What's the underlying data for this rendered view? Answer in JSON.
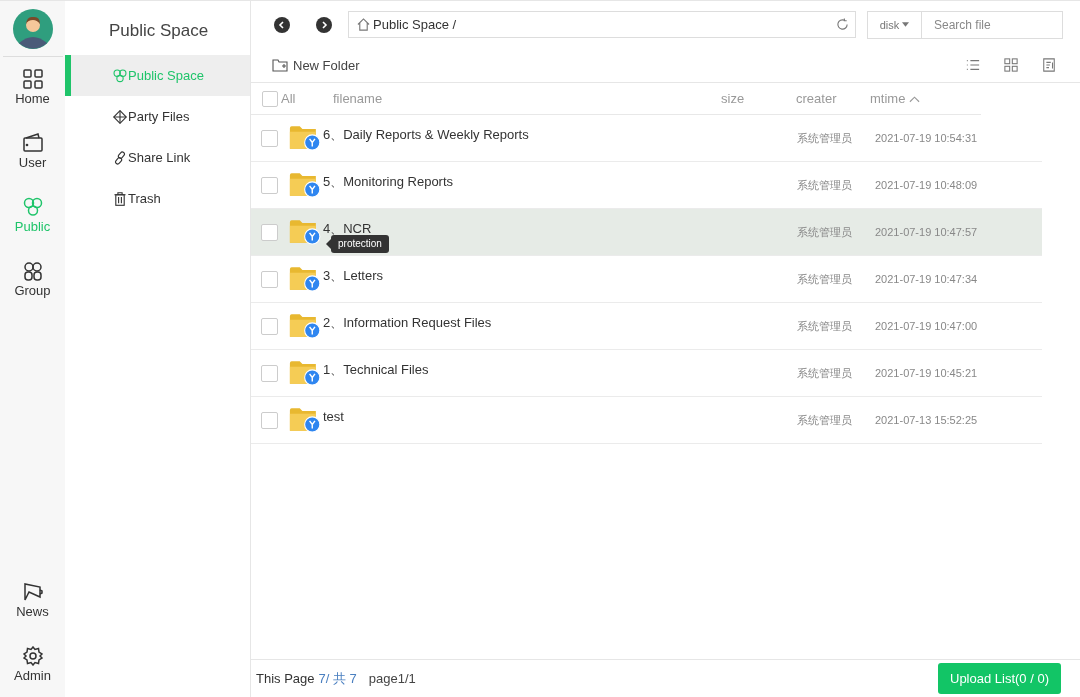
{
  "rail": {
    "items": [
      {
        "label": "Home",
        "selected": false
      },
      {
        "label": "User",
        "selected": false
      },
      {
        "label": "Public",
        "selected": true
      },
      {
        "label": "Group",
        "selected": false
      }
    ],
    "bottom_items": [
      {
        "label": "News",
        "selected": false
      },
      {
        "label": "Admin",
        "selected": false
      }
    ]
  },
  "sidebar": {
    "title": "Public Space",
    "items": [
      {
        "label": "Public Space",
        "selected": true
      },
      {
        "label": "Party Files",
        "selected": false
      },
      {
        "label": "Share Link",
        "selected": false
      },
      {
        "label": "Trash",
        "selected": false
      }
    ]
  },
  "toolbar": {
    "path": "Public Space /",
    "disk": "disk",
    "search": {
      "placeholder": "Search file"
    },
    "new_folder": "New Folder"
  },
  "table": {
    "select_all_checked": false,
    "columns": {
      "all": "All",
      "filename": "filename",
      "size": "size",
      "creater": "creater",
      "mtime": "mtime"
    },
    "rows": [
      {
        "name": "6、Daily Reports & Weekly Reports",
        "creater": "系统管理员",
        "mtime": "2021-07-19 10:54:31",
        "checked": false,
        "hovered": false
      },
      {
        "name": "5、Monitoring Reports",
        "creater": "系统管理员",
        "mtime": "2021-07-19 10:48:09",
        "checked": false,
        "hovered": false
      },
      {
        "name": "4、NCR",
        "creater": "系统管理员",
        "mtime": "2021-07-19 10:47:57",
        "checked": false,
        "hovered": true,
        "tooltip": "protection"
      },
      {
        "name": "3、Letters",
        "creater": "系统管理员",
        "mtime": "2021-07-19 10:47:34",
        "checked": false,
        "hovered": false
      },
      {
        "name": "2、Information Request Files",
        "creater": "系统管理员",
        "mtime": "2021-07-19 10:47:00",
        "checked": false,
        "hovered": false
      },
      {
        "name": "1、Technical Files",
        "creater": "系统管理员",
        "mtime": "2021-07-19 10:45:21",
        "checked": false,
        "hovered": false
      },
      {
        "name": "test",
        "creater": "系统管理员",
        "mtime": "2021-07-13 15:52:25",
        "checked": false,
        "hovered": false
      }
    ]
  },
  "footer": {
    "label": "This Page",
    "count": "7/ 共 7",
    "pages": "page1/1",
    "upload": "Upload List(0 / 0)"
  }
}
